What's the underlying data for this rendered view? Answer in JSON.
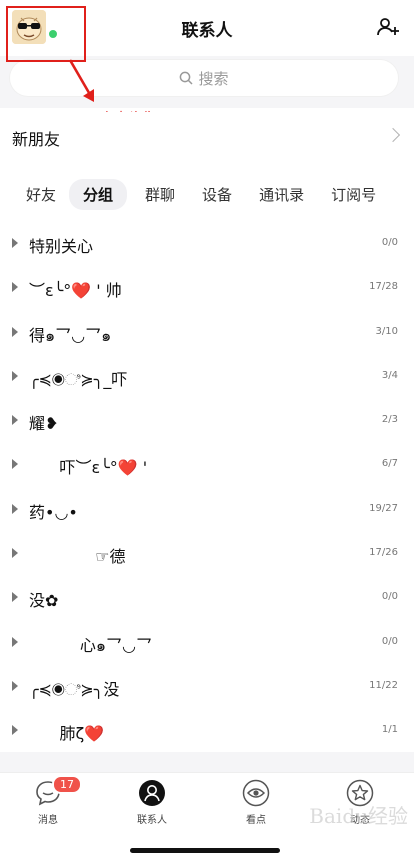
{
  "header": {
    "title": "联系人"
  },
  "search": {
    "placeholder": "搜索"
  },
  "annotation": {
    "text": "点击头像",
    "color": "#e0201b"
  },
  "new_friends": {
    "label": "新朋友"
  },
  "tabs": [
    {
      "label": "好友",
      "active": false
    },
    {
      "label": "分组",
      "active": true
    },
    {
      "label": "群聊",
      "active": false
    },
    {
      "label": "设备",
      "active": false
    },
    {
      "label": "通讯录",
      "active": false
    },
    {
      "label": "订阅号",
      "active": false
    }
  ],
  "groups": [
    {
      "name": "特别关心",
      "count": "0/0"
    },
    {
      "name": "︶ε╰°❤️ ' 帅",
      "count": "17/28"
    },
    {
      "name": "得๑乛◡乛๑",
      "count": "3/10"
    },
    {
      "name": "╭≼◉ಿ≽╮_吓",
      "count": "3/4"
    },
    {
      "name": "耀❥",
      "count": "2/3"
    },
    {
      "name": "      吓︶ε╰°❤️ '",
      "count": "6/7"
    },
    {
      "name": "药•◡•",
      "count": "19/27"
    },
    {
      "name": "             ☞德",
      "count": "17/26"
    },
    {
      "name": "没✿",
      "count": "0/0"
    },
    {
      "name": "          心๑乛◡乛",
      "count": "0/0"
    },
    {
      "name": "╭≼◉ಿ≽╮没",
      "count": "11/22"
    },
    {
      "name": "      肺ζ❤️",
      "count": "1/1"
    }
  ],
  "tabbar": {
    "items": [
      {
        "label": "消息",
        "badge": "17"
      },
      {
        "label": "联系人"
      },
      {
        "label": "看点"
      },
      {
        "label": "动态"
      }
    ]
  },
  "colors": {
    "online": "#3ccf6e",
    "badge": "#f0524a",
    "accent_red": "#e0201b"
  },
  "watermark": "Baidu经验"
}
